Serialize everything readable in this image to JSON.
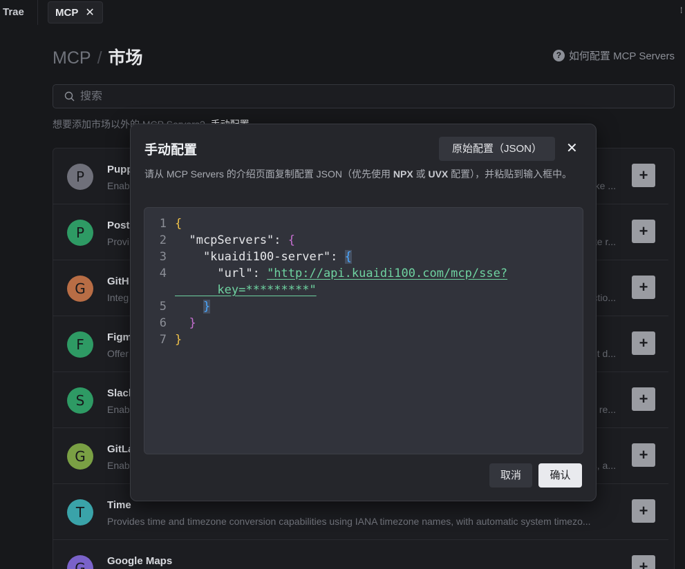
{
  "tabs": [
    {
      "label": "Trae"
    },
    {
      "label": "MCP",
      "close": "✕"
    }
  ],
  "kbd_hint": "⁞",
  "header": {
    "root": "MCP",
    "separator": "/",
    "current": "市场",
    "help_icon": "?",
    "help_label": "如何配置 MCP Servers"
  },
  "search": {
    "placeholder": "搜索"
  },
  "hint": {
    "text": "想要添加市场以外的 MCP Servers?",
    "manual_link": "手动配置"
  },
  "servers": [
    {
      "initial": "P",
      "title": "Pupp",
      "desc": "Enab",
      "tail": "ake ...",
      "color": "#6f707a"
    },
    {
      "initial": "P",
      "title": "Post",
      "desc": "Provi",
      "tail": "te r...",
      "color": "#2e9a64"
    },
    {
      "initial": "G",
      "title": "GitH",
      "desc": "Integ",
      "tail": "ctio...",
      "color": "#b86d45"
    },
    {
      "initial": "F",
      "title": "Figm",
      "desc": "Offer",
      "tail": "nt d...",
      "color": "#2e9a64"
    },
    {
      "initial": "S",
      "title": "Slack",
      "desc": "Enab",
      "tail": "t, re...",
      "color": "#2e9a64"
    },
    {
      "initial": "G",
      "title": "GitLa",
      "desc": "Enab",
      "tail": "s, a...",
      "color": "#7aa044"
    },
    {
      "initial": "T",
      "title": "Time",
      "desc": "Provides time and timezone conversion capabilities using IANA timezone names, with automatic system timezo...",
      "tail": "",
      "color": "#3aa3a9"
    },
    {
      "initial": "G",
      "title": "Google Maps",
      "desc": "",
      "tail": "",
      "color": "#7a62c9"
    }
  ],
  "add_label": "+",
  "modal": {
    "title": "手动配置",
    "raw_button": "原始配置（JSON）",
    "close": "✕",
    "desc_before": "请从 MCP Servers 的介绍页面复制配置 JSON（优先使用 ",
    "desc_npx": "NPX",
    "desc_or": " 或 ",
    "desc_uvx": "UVX",
    "desc_after": " 配置），并粘贴到输入框中。",
    "code_lines": [
      {
        "n": "1",
        "parts": [
          {
            "t": "{",
            "c": "brace-y"
          }
        ]
      },
      {
        "n": "2",
        "parts": [
          {
            "t": "  \"mcpServers\": ",
            "c": ""
          },
          {
            "t": "{",
            "c": "brace-m"
          }
        ]
      },
      {
        "n": "3",
        "parts": [
          {
            "t": "    \"kuaidi100-server\": ",
            "c": ""
          },
          {
            "t": "{",
            "c": "brace-b"
          }
        ]
      },
      {
        "n": "4",
        "parts": [
          {
            "t": "      \"url\": ",
            "c": ""
          },
          {
            "t": "\"http://api.kuaidi100.com/mcp/sse?",
            "c": "str-url"
          }
        ]
      },
      {
        "n": "",
        "parts": [
          {
            "t": "      key=*********\"",
            "c": "str-url"
          }
        ]
      },
      {
        "n": "5",
        "parts": [
          {
            "t": "    ",
            "c": ""
          },
          {
            "t": "}",
            "c": "brace-b"
          }
        ]
      },
      {
        "n": "6",
        "parts": [
          {
            "t": "  ",
            "c": ""
          },
          {
            "t": "}",
            "c": "brace-m"
          }
        ]
      },
      {
        "n": "7",
        "parts": [
          {
            "t": "}",
            "c": "brace-y"
          }
        ]
      }
    ],
    "cancel": "取消",
    "confirm": "确认"
  }
}
